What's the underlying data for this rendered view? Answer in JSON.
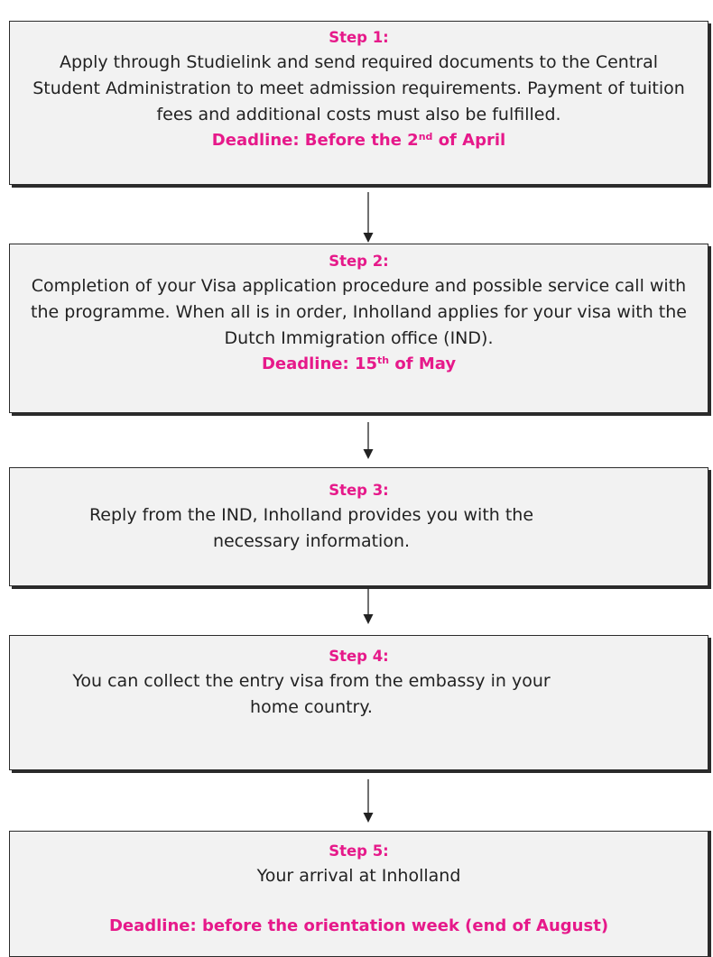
{
  "colors": {
    "accent": "#e6198a",
    "box_fill": "#f2f2f2",
    "border": "#2b2b2b",
    "text": "#222222"
  },
  "steps": [
    {
      "title": "Step 1:",
      "body": "Apply through Studielink and send required documents to the Central Student Administration to meet admission requirements. Payment of tuition fees and additional costs must also be fulfilled.",
      "deadline_pre": "Deadline: Before the 2",
      "deadline_sup": "nd",
      "deadline_post": " of April"
    },
    {
      "title": "Step 2:",
      "body": "Completion of your Visa application procedure and possible service call with the programme. When all is in order, Inholland applies for your visa with the Dutch Immigration office (IND).",
      "deadline_pre": "Deadline: 15",
      "deadline_sup": "th",
      "deadline_post": " of May"
    },
    {
      "title": "Step 3:",
      "body": "Reply from the IND, Inholland provides you with the necessary information."
    },
    {
      "title": "Step 4:",
      "body": "You can collect the entry visa from the embassy in your home country."
    },
    {
      "title": "Step 5:",
      "body": "Your arrival at Inholland",
      "deadline": "Deadline: before the orientation week (end of August)"
    }
  ]
}
